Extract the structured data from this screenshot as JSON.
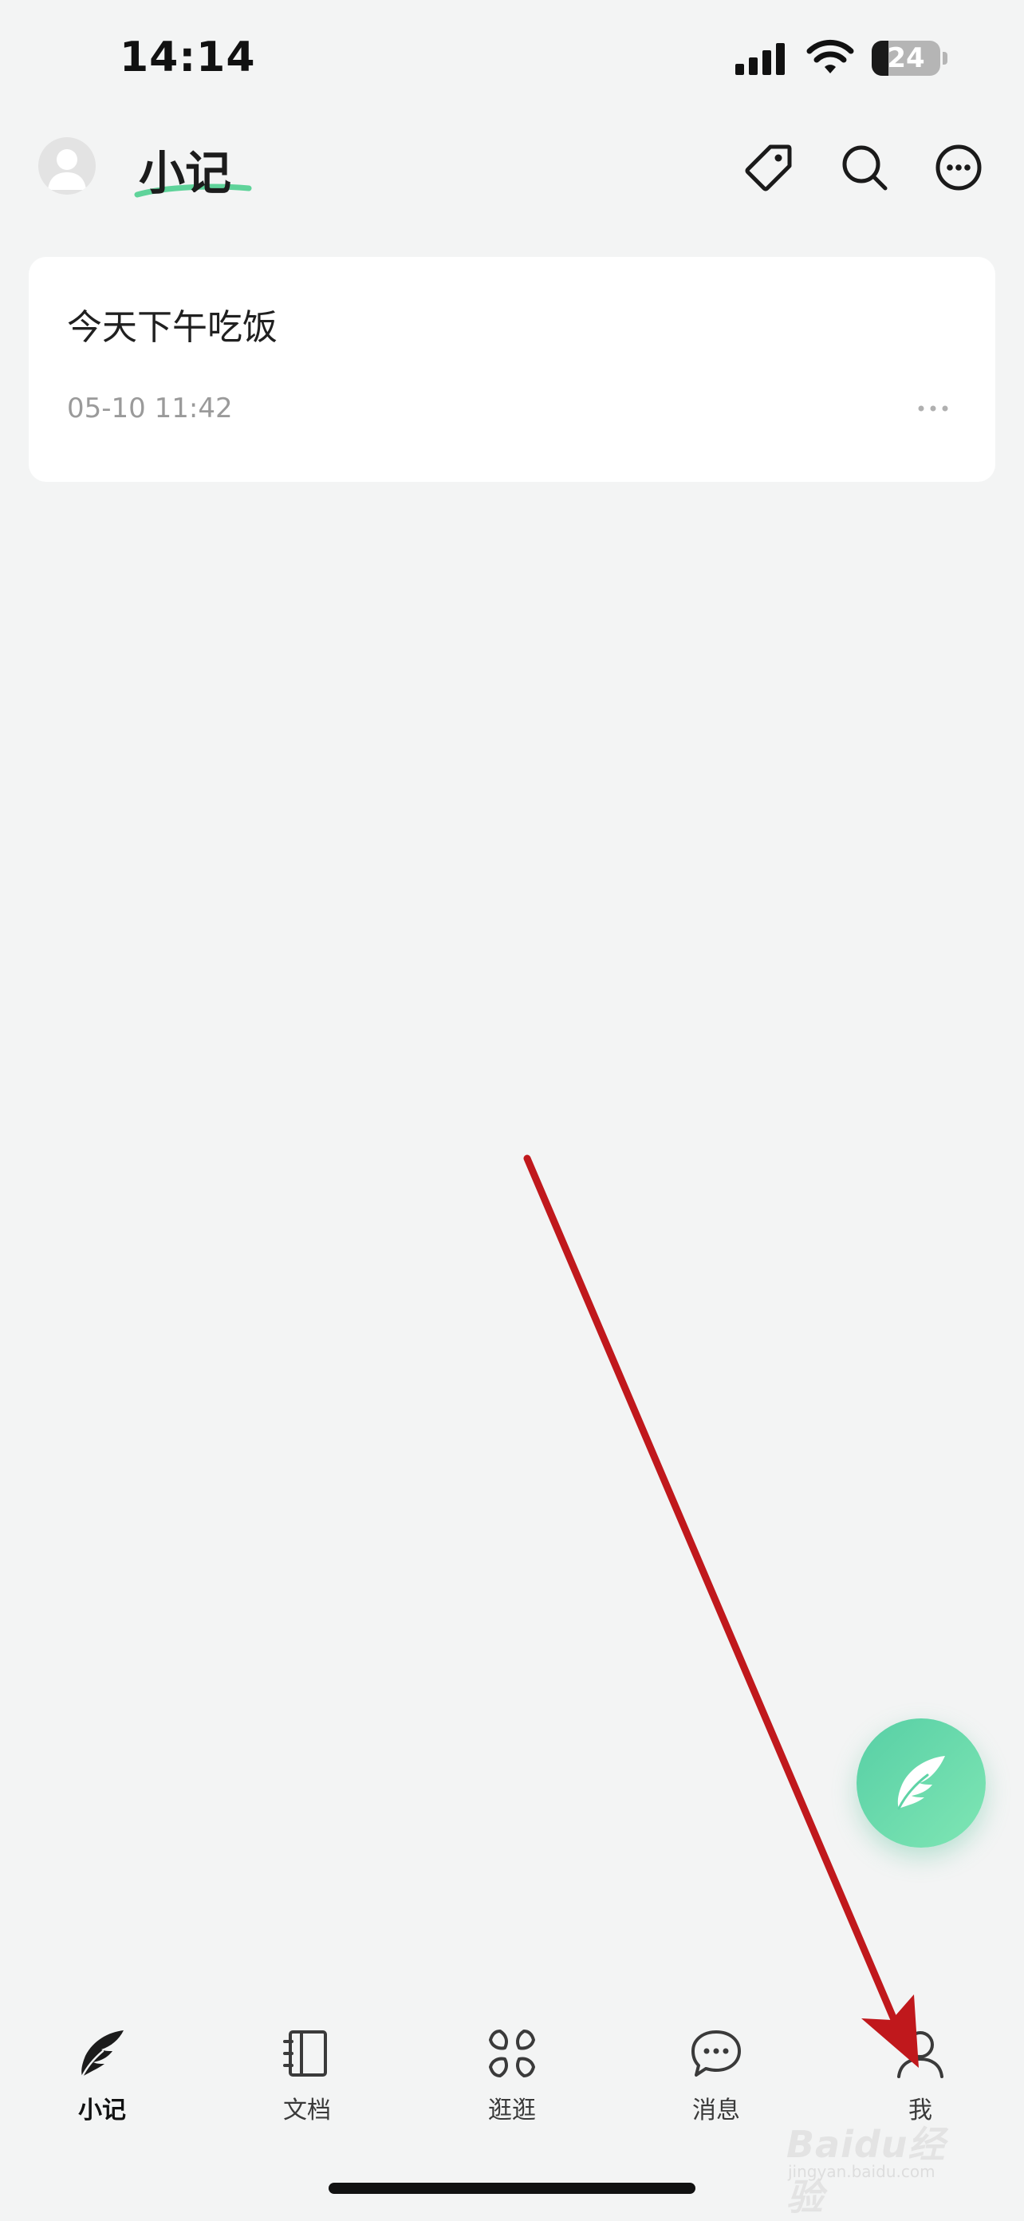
{
  "status_bar": {
    "time": "14:14",
    "battery_level": "24",
    "battery_fraction": 0.24,
    "icons": [
      "signal-icon",
      "wifi-icon",
      "battery-icon"
    ]
  },
  "header": {
    "title": "小记",
    "avatar_icon": "person-avatar-icon",
    "accent_color": "#5fd39a",
    "actions": [
      {
        "name": "tag-icon"
      },
      {
        "name": "search-icon"
      },
      {
        "name": "more-icon"
      }
    ]
  },
  "notes": [
    {
      "title": "今天下午吃饭",
      "time": "05-10 11:42"
    }
  ],
  "fab": {
    "icon": "feather-icon",
    "color": "#5ed3a6"
  },
  "tabs": [
    {
      "label": "小记",
      "icon": "feather-icon",
      "active": true
    },
    {
      "label": "文档",
      "icon": "notebook-icon",
      "active": false
    },
    {
      "label": "逛逛",
      "icon": "grid-icon",
      "active": false
    },
    {
      "label": "消息",
      "icon": "chat-bubble-icon",
      "active": false
    },
    {
      "label": "我",
      "icon": "person-icon",
      "active": false
    }
  ],
  "annotation": {
    "color": "#c0181c"
  },
  "watermark": {
    "text": "Baidu经验",
    "sub": "jingyan.baidu.com"
  }
}
